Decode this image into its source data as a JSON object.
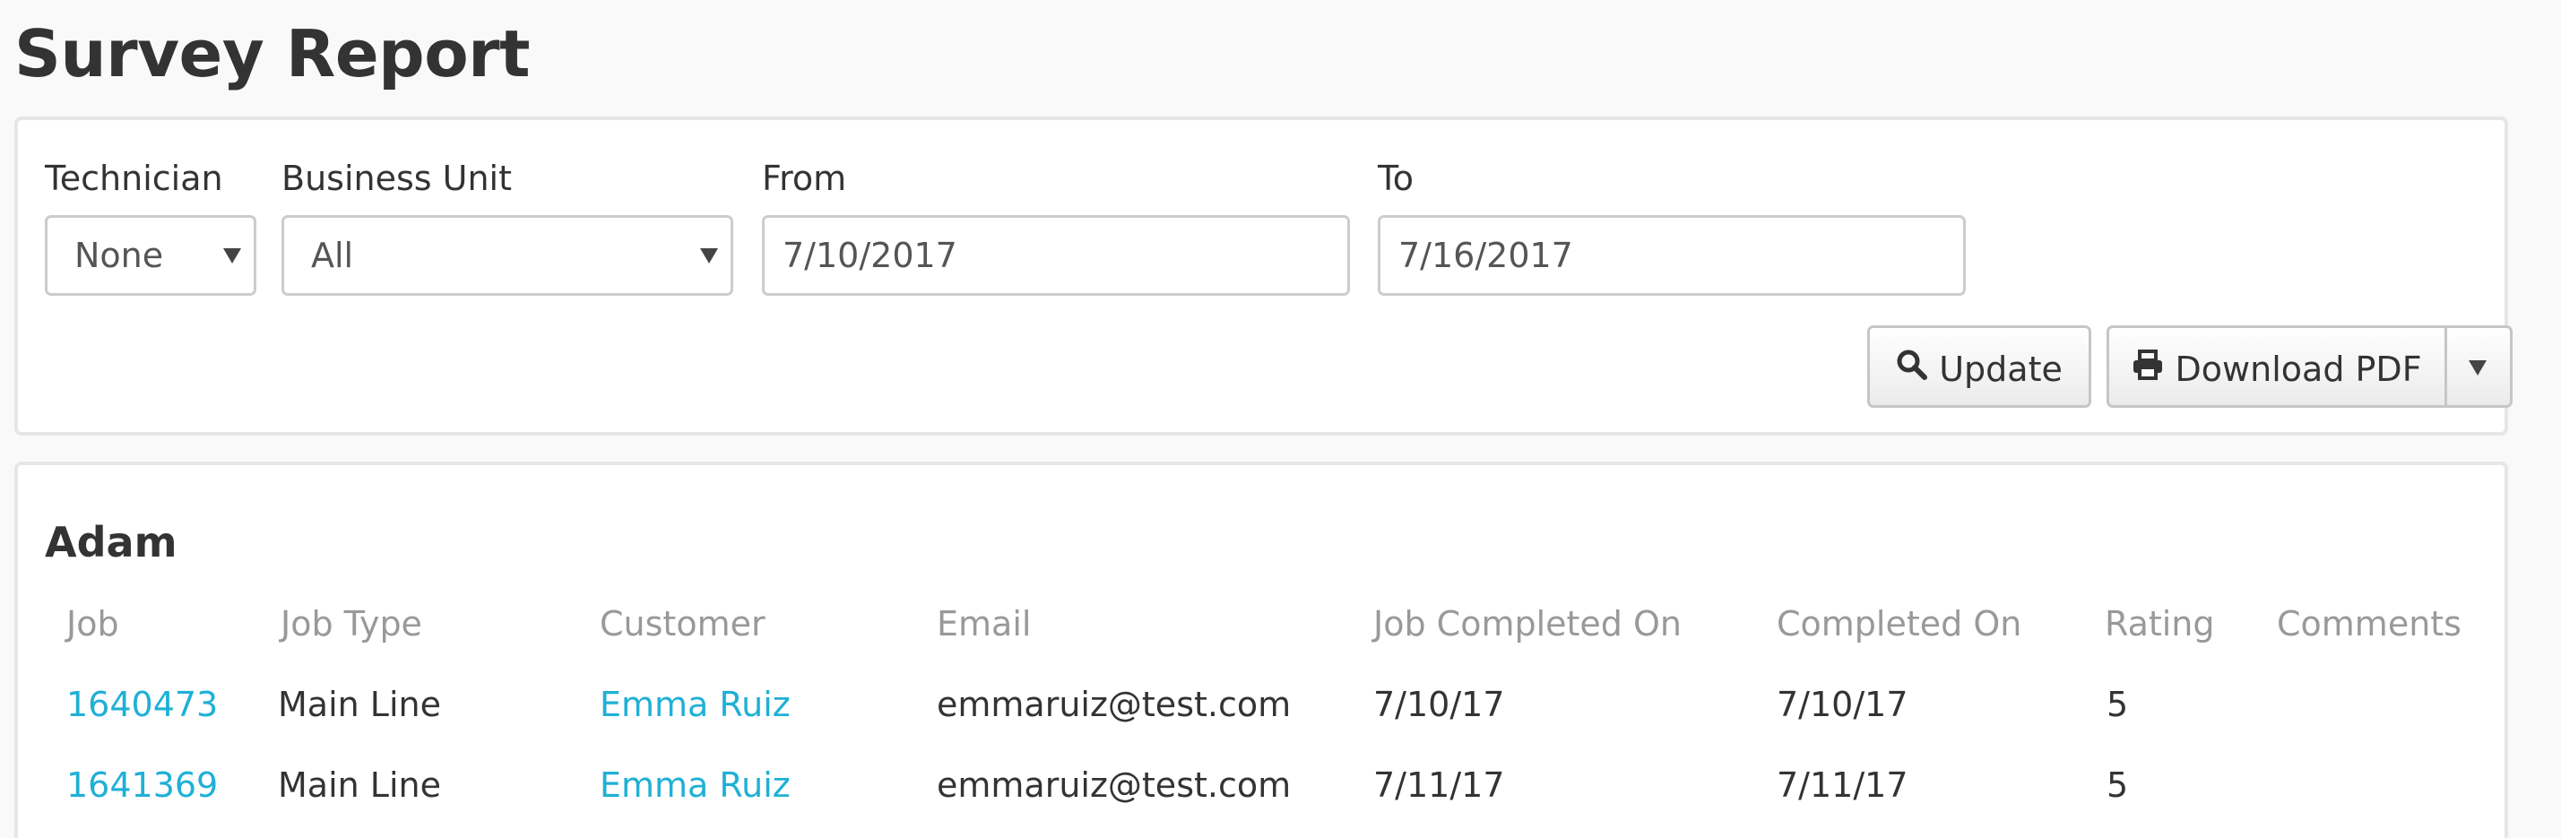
{
  "page": {
    "title": "Survey Report"
  },
  "filters": {
    "technician": {
      "label": "Technician",
      "value": "None"
    },
    "business_unit": {
      "label": "Business Unit",
      "value": "All"
    },
    "from": {
      "label": "From",
      "value": "7/10/2017"
    },
    "to": {
      "label": "To",
      "value": "7/16/2017"
    }
  },
  "toolbar": {
    "update_label": "Update",
    "download_label": "Download PDF"
  },
  "icons": {
    "update": "search-icon",
    "download": "print-icon",
    "dropdown": "caret-down-icon"
  },
  "colors": {
    "link": "#1fb0d6",
    "header_text": "#999999",
    "text": "#333333",
    "background": "#f9f9f9"
  },
  "report": {
    "technician_name": "Adam",
    "columns": [
      "Job",
      "Job Type",
      "Customer",
      "Email",
      "Job Completed On",
      "Completed On",
      "Rating",
      "Comments"
    ],
    "rows": [
      {
        "job": "1640473",
        "job_type": "Main Line",
        "customer": "Emma Ruiz",
        "email": "emmaruiz@test.com",
        "job_completed_on": "7/10/17",
        "completed_on": "7/10/17",
        "rating": "5",
        "comments": ""
      },
      {
        "job": "1641369",
        "job_type": "Main Line",
        "customer": "Emma Ruiz",
        "email": "emmaruiz@test.com",
        "job_completed_on": "7/11/17",
        "completed_on": "7/11/17",
        "rating": "5",
        "comments": ""
      }
    ]
  }
}
